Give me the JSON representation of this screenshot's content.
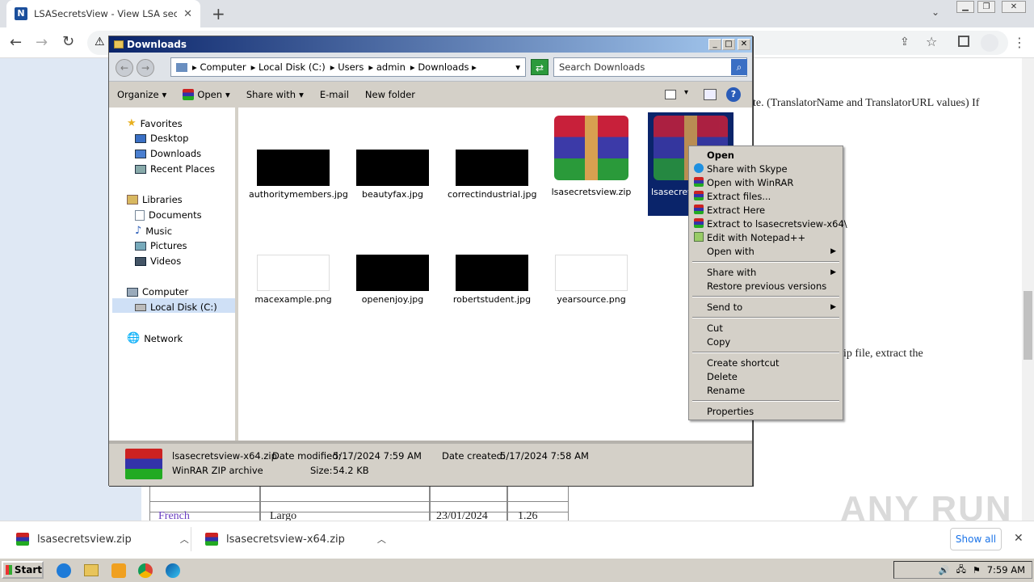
{
  "browser": {
    "tab_title": "LSASecretsView - View LSA secrets s",
    "new_tab": "+",
    "nav": {
      "back": "←",
      "forward": "→",
      "reload": "↻"
    }
  },
  "page": {
    "text_line1": "te. (TranslatorName and TranslatorURL values) If",
    "text_line2": "ip file, extract the",
    "table_row": {
      "lang": "French",
      "name": "Largo",
      "date": "23/01/2024",
      "version": "1.26"
    }
  },
  "explorer": {
    "title": "Downloads",
    "breadcrumb": [
      "Computer",
      "Local Disk (C:)",
      "Users",
      "admin",
      "Downloads"
    ],
    "search_placeholder": "Search Downloads",
    "commands": [
      "Organize",
      "Open",
      "Share with",
      "E-mail",
      "New folder"
    ],
    "nav": {
      "favorites": "Favorites",
      "favorites_items": [
        "Desktop",
        "Downloads",
        "Recent Places"
      ],
      "libraries": "Libraries",
      "libraries_items": [
        "Documents",
        "Music",
        "Pictures",
        "Videos"
      ],
      "computer": "Computer",
      "computer_items": [
        "Local Disk (C:)"
      ],
      "network": "Network"
    },
    "files": [
      {
        "name": "authoritymembers.jpg",
        "type": "dark"
      },
      {
        "name": "beautyfax.jpg",
        "type": "dark"
      },
      {
        "name": "correctindustrial.jpg",
        "type": "dark"
      },
      {
        "name": "lsasecretsview.zip",
        "type": "rar"
      },
      {
        "name": "lsasecretsview-x64.zip",
        "type": "rar"
      },
      {
        "name": "macexample.png",
        "type": "light"
      },
      {
        "name": "openenjoy.jpg",
        "type": "dark"
      },
      {
        "name": "robertstudent.jpg",
        "type": "dark"
      },
      {
        "name": "yearsource.png",
        "type": "light"
      }
    ],
    "selected_label_visible": "lsasecrets",
    "status": {
      "filename": "lsasecretsview-x64.zip",
      "date_modified_label": "Date modified:",
      "date_modified": "5/17/2024 7:59 AM",
      "date_created_label": "Date created:",
      "date_created": "5/17/2024 7:58 AM",
      "type": "WinRAR ZIP archive",
      "size_label": "Size:",
      "size": "54.2 KB"
    }
  },
  "context_menu": [
    {
      "label": "Open",
      "bold": true
    },
    {
      "label": "Share with Skype",
      "icon": "skype-icon"
    },
    {
      "label": "Open with WinRAR",
      "icon": "winrar-icon"
    },
    {
      "label": "Extract files...",
      "icon": "winrar-icon"
    },
    {
      "label": "Extract Here",
      "icon": "winrar-icon"
    },
    {
      "label": "Extract to lsasecretsview-x64\\",
      "icon": "winrar-icon"
    },
    {
      "label": "Edit with Notepad++",
      "icon": "notepad-icon"
    },
    {
      "label": "Open with",
      "submenu": true
    },
    {
      "label": "Share with",
      "submenu": true
    },
    {
      "label": "Restore previous versions"
    },
    {
      "label": "Send to",
      "submenu": true
    },
    {
      "label": "Cut"
    },
    {
      "label": "Copy"
    },
    {
      "label": "Create shortcut"
    },
    {
      "label": "Delete"
    },
    {
      "label": "Rename"
    },
    {
      "label": "Properties"
    }
  ],
  "downloads_bar": {
    "items": [
      "lsasecretsview.zip",
      "lsasecretsview-x64.zip"
    ],
    "show_all": "Show all",
    "close": "✕"
  },
  "taskbar": {
    "start": "Start",
    "clock": "7:59 AM"
  },
  "watermark": "ANY RUN"
}
